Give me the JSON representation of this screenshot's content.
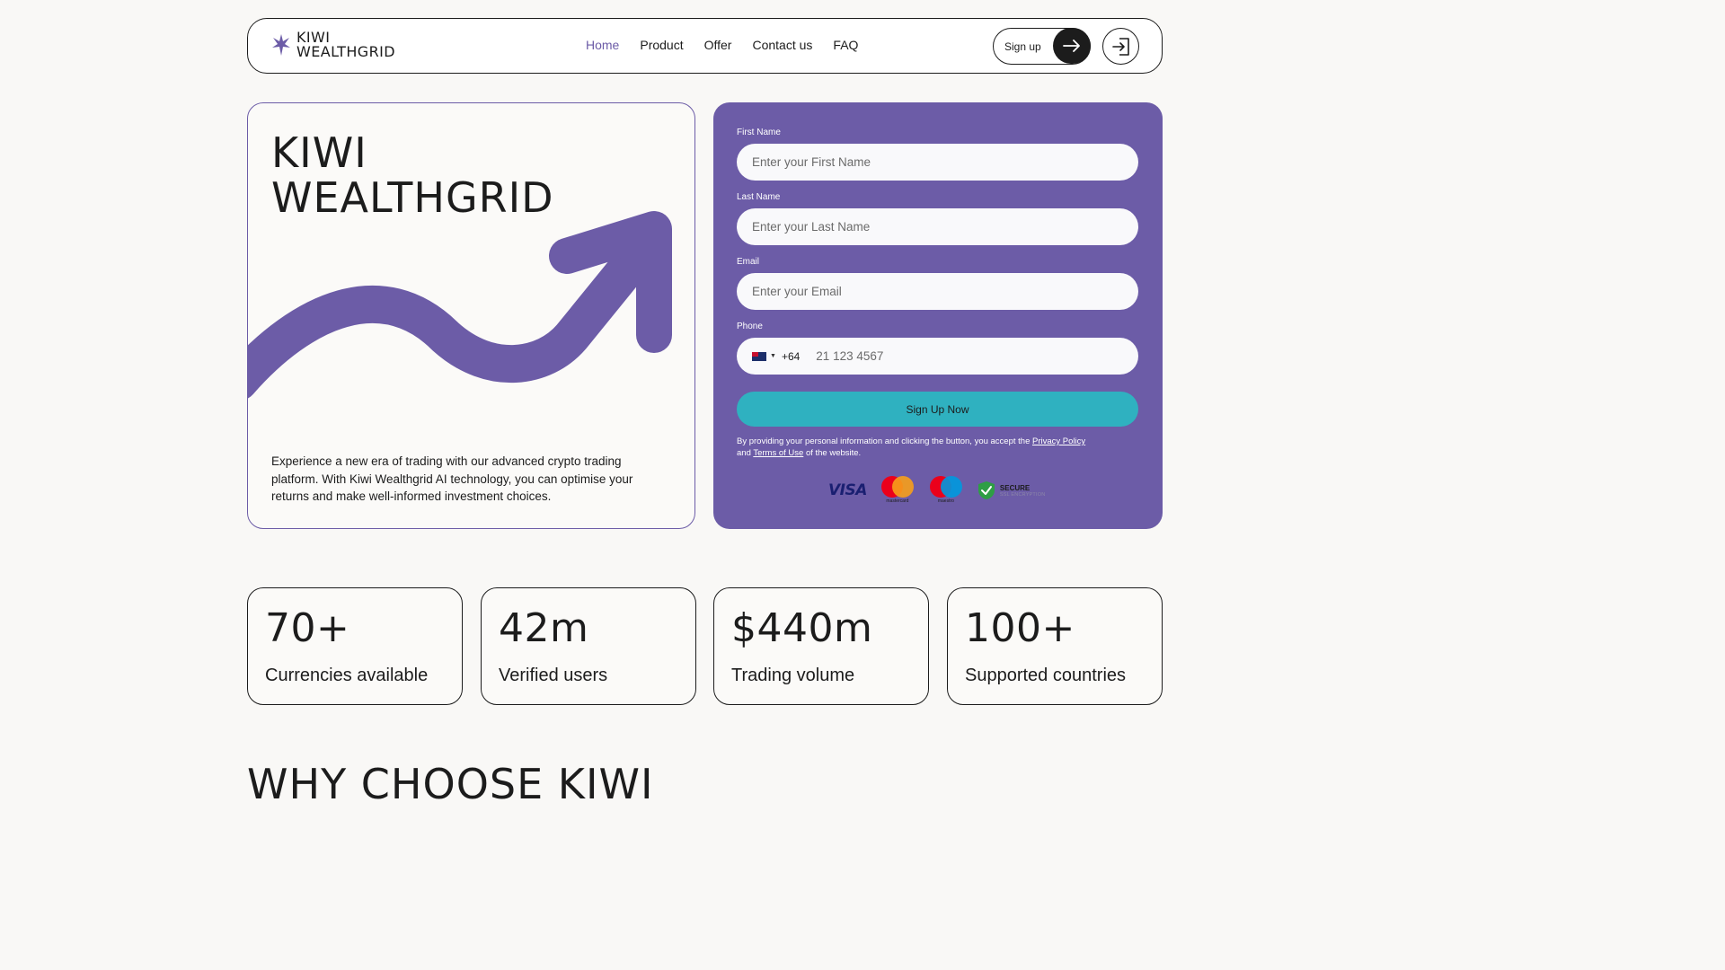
{
  "brand": {
    "line1": "KIWI",
    "line2": "WEALTHGRID",
    "accent": "#6c5ca7"
  },
  "nav": {
    "items": [
      {
        "label": "Home",
        "active": true
      },
      {
        "label": "Product"
      },
      {
        "label": "Offer"
      },
      {
        "label": "Contact us"
      },
      {
        "label": "FAQ"
      }
    ],
    "signup_label": "Sign up",
    "signup_icon": "arrow-right-icon",
    "login_icon": "login-icon"
  },
  "hero": {
    "title_line1": "KIWI",
    "title_line2": "WEALTHGRID",
    "description": "Experience a new era of trading with our advanced crypto trading platform. With Kiwi Wealthgrid AI technology, you can optimise your returns and make well-informed investment choices."
  },
  "form": {
    "first_name_label": "First Name",
    "first_name_placeholder": "Enter your First Name",
    "last_name_label": "Last Name",
    "last_name_placeholder": "Enter your Last Name",
    "email_label": "Email",
    "email_placeholder": "Enter your Email",
    "phone_label": "Phone",
    "phone_dial_code": "+64",
    "phone_placeholder": "21 123 4567",
    "submit_label": "Sign Up Now",
    "submit_color": "#2fb1c0",
    "legal_prefix": "By providing your personal information and clicking the button, you accept the",
    "privacy_link": "Privacy Policy",
    "legal_mid": "and",
    "terms_link": "Terms of Use",
    "legal_suffix": "of the website.",
    "badges": {
      "visa": "VISA",
      "mastercard": "mastercard",
      "maestro": "maestro",
      "secure_title": "SECURE",
      "secure_sub": "SSL ENCRYPTION"
    }
  },
  "stats": [
    {
      "value": "70+",
      "label": "Currencies available"
    },
    {
      "value": "42m",
      "label": "Verified users"
    },
    {
      "value": "$440m",
      "label": "Trading volume"
    },
    {
      "value": "100+",
      "label": "Supported countries"
    }
  ],
  "section_heading": "WHY CHOOSE KIWI"
}
